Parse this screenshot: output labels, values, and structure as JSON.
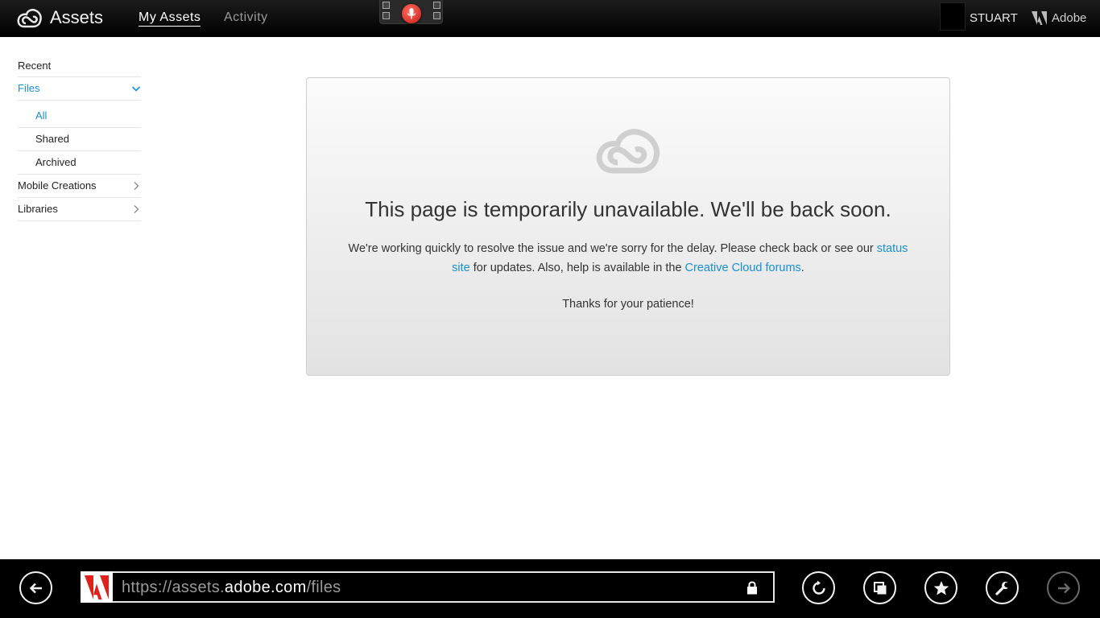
{
  "header": {
    "app_title": "Assets",
    "tabs": [
      {
        "label": "My Assets",
        "active": true
      },
      {
        "label": "Activity",
        "active": false
      }
    ],
    "user_name": "STUART",
    "brand_label": "Adobe"
  },
  "sidebar": {
    "items": [
      {
        "label": "Recent"
      },
      {
        "label": "Files",
        "active": true,
        "expanded": true
      },
      {
        "label": "All",
        "active": true,
        "sub": true
      },
      {
        "label": "Shared",
        "sub": true
      },
      {
        "label": "Archived",
        "sub": true
      },
      {
        "label": "Mobile Creations"
      },
      {
        "label": "Libraries"
      }
    ]
  },
  "main": {
    "heading": "This page is temporarily unavailable. We'll be back soon.",
    "message_before": "We're working quickly to resolve the issue and we're sorry for the delay. Please check back or see our ",
    "status_link": "status site",
    "message_middle": " for updates. Also, help is available in the ",
    "forums_link": "Creative Cloud forums",
    "message_after": ".",
    "thanks": "Thanks for your patience!"
  },
  "browser": {
    "url_scheme": "https://",
    "url_sub": "assets.",
    "url_host": "adobe.com",
    "url_path": "/files",
    "buttons": [
      "back-icon",
      "refresh-icon",
      "tabs-icon",
      "favorite-icon",
      "tools-icon",
      "forward-icon"
    ]
  },
  "colors": {
    "accent": "#1a8fd0",
    "topbar": "#000000",
    "mic": "#e03b2f"
  }
}
